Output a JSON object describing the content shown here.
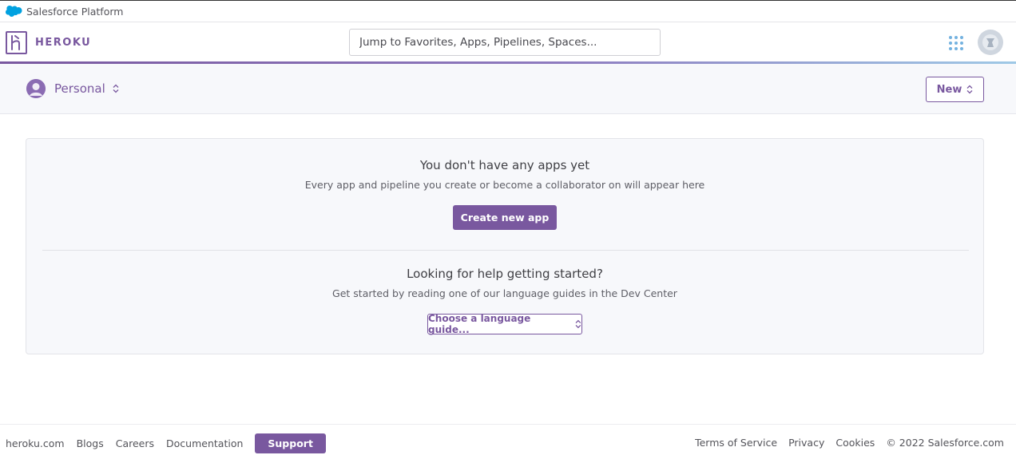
{
  "platform_bar": {
    "label": "Salesforce Platform"
  },
  "header": {
    "brand": "HEROKU",
    "search_placeholder": "Jump to Favorites, Apps, Pipelines, Spaces...",
    "apps_icon": "grid-dots-icon",
    "avatar_icon": "user-avatar-icon"
  },
  "subnav": {
    "account_label": "Personal",
    "new_label": "New"
  },
  "empty_state": {
    "title": "You don't have any apps yet",
    "subtitle": "Every app and pipeline you create or become a collaborator on will appear here",
    "create_label": "Create new app",
    "help_title": "Looking for help getting started?",
    "help_subtitle": "Get started by reading one of our language guides in the Dev Center",
    "language_select": "Choose a language guide..."
  },
  "footer": {
    "left_links": [
      "heroku.com",
      "Blogs",
      "Careers",
      "Documentation"
    ],
    "support_label": "Support",
    "right_links": [
      "Terms of Service",
      "Privacy",
      "Cookies"
    ],
    "copyright": "© 2022 Salesforce.com"
  },
  "colors": {
    "brand_purple": "#79589f",
    "subnav_bg": "#f7f8fb",
    "salesforce_blue": "#00a1e0"
  }
}
